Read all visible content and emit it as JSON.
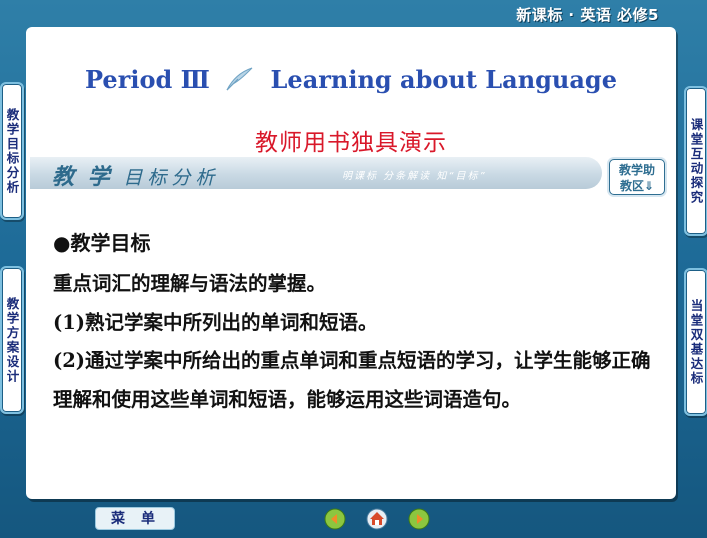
{
  "header": {
    "title": "新课标 · 英语    必修5"
  },
  "slide": {
    "period_lead": "Period Ⅲ",
    "period_rest": "Learning about Language",
    "subtitle": "教师用书独具演示",
    "banner": {
      "bold": "教 学",
      "light": "目标分析",
      "tagline": "明课标  分条解读  知“目标”"
    },
    "assist_button": {
      "line1": "教学助",
      "line2": "教区⇓"
    },
    "goal_heading": "●教学目标",
    "lines": [
      "重点词汇的理解与语法的掌握。",
      "(1)熟记学案中所列出的单词和短语。",
      "(2)通过学案中所给出的重点单词和重点短语的学习，让学生能够正确理解和使用这些单词和短语，能够运用这些词语造句。"
    ]
  },
  "left_tabs": [
    "教学目标分析",
    "教学方案设计"
  ],
  "right_tabs": [
    "课堂互动探究",
    "当堂双基达标"
  ],
  "bottom": {
    "menu_label": "菜单",
    "nav_icons": [
      "prev-icon",
      "home-icon",
      "next-icon"
    ]
  },
  "colors": {
    "background": "#1d6a97",
    "title_blue": "#2a4fb0",
    "subtitle_red": "#d9182a",
    "tab_text": "#1a2c7a"
  }
}
